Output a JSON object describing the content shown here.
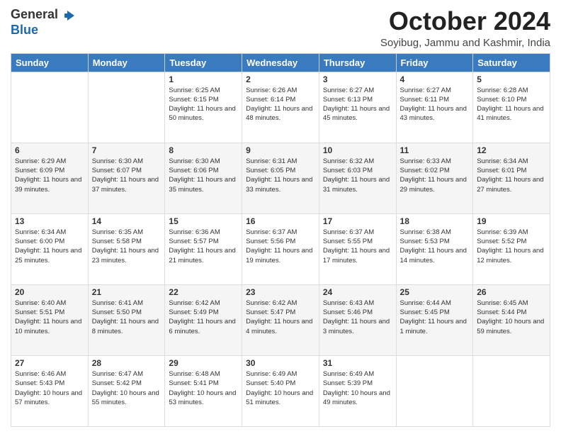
{
  "header": {
    "logo_general": "General",
    "logo_blue": "Blue",
    "month_title": "October 2024",
    "subtitle": "Soyibug, Jammu and Kashmir, India"
  },
  "days_of_week": [
    "Sunday",
    "Monday",
    "Tuesday",
    "Wednesday",
    "Thursday",
    "Friday",
    "Saturday"
  ],
  "weeks": [
    [
      {
        "day": "",
        "sunrise": "",
        "sunset": "",
        "daylight": ""
      },
      {
        "day": "",
        "sunrise": "",
        "sunset": "",
        "daylight": ""
      },
      {
        "day": "1",
        "sunrise": "Sunrise: 6:25 AM",
        "sunset": "Sunset: 6:15 PM",
        "daylight": "Daylight: 11 hours and 50 minutes."
      },
      {
        "day": "2",
        "sunrise": "Sunrise: 6:26 AM",
        "sunset": "Sunset: 6:14 PM",
        "daylight": "Daylight: 11 hours and 48 minutes."
      },
      {
        "day": "3",
        "sunrise": "Sunrise: 6:27 AM",
        "sunset": "Sunset: 6:13 PM",
        "daylight": "Daylight: 11 hours and 45 minutes."
      },
      {
        "day": "4",
        "sunrise": "Sunrise: 6:27 AM",
        "sunset": "Sunset: 6:11 PM",
        "daylight": "Daylight: 11 hours and 43 minutes."
      },
      {
        "day": "5",
        "sunrise": "Sunrise: 6:28 AM",
        "sunset": "Sunset: 6:10 PM",
        "daylight": "Daylight: 11 hours and 41 minutes."
      }
    ],
    [
      {
        "day": "6",
        "sunrise": "Sunrise: 6:29 AM",
        "sunset": "Sunset: 6:09 PM",
        "daylight": "Daylight: 11 hours and 39 minutes."
      },
      {
        "day": "7",
        "sunrise": "Sunrise: 6:30 AM",
        "sunset": "Sunset: 6:07 PM",
        "daylight": "Daylight: 11 hours and 37 minutes."
      },
      {
        "day": "8",
        "sunrise": "Sunrise: 6:30 AM",
        "sunset": "Sunset: 6:06 PM",
        "daylight": "Daylight: 11 hours and 35 minutes."
      },
      {
        "day": "9",
        "sunrise": "Sunrise: 6:31 AM",
        "sunset": "Sunset: 6:05 PM",
        "daylight": "Daylight: 11 hours and 33 minutes."
      },
      {
        "day": "10",
        "sunrise": "Sunrise: 6:32 AM",
        "sunset": "Sunset: 6:03 PM",
        "daylight": "Daylight: 11 hours and 31 minutes."
      },
      {
        "day": "11",
        "sunrise": "Sunrise: 6:33 AM",
        "sunset": "Sunset: 6:02 PM",
        "daylight": "Daylight: 11 hours and 29 minutes."
      },
      {
        "day": "12",
        "sunrise": "Sunrise: 6:34 AM",
        "sunset": "Sunset: 6:01 PM",
        "daylight": "Daylight: 11 hours and 27 minutes."
      }
    ],
    [
      {
        "day": "13",
        "sunrise": "Sunrise: 6:34 AM",
        "sunset": "Sunset: 6:00 PM",
        "daylight": "Daylight: 11 hours and 25 minutes."
      },
      {
        "day": "14",
        "sunrise": "Sunrise: 6:35 AM",
        "sunset": "Sunset: 5:58 PM",
        "daylight": "Daylight: 11 hours and 23 minutes."
      },
      {
        "day": "15",
        "sunrise": "Sunrise: 6:36 AM",
        "sunset": "Sunset: 5:57 PM",
        "daylight": "Daylight: 11 hours and 21 minutes."
      },
      {
        "day": "16",
        "sunrise": "Sunrise: 6:37 AM",
        "sunset": "Sunset: 5:56 PM",
        "daylight": "Daylight: 11 hours and 19 minutes."
      },
      {
        "day": "17",
        "sunrise": "Sunrise: 6:37 AM",
        "sunset": "Sunset: 5:55 PM",
        "daylight": "Daylight: 11 hours and 17 minutes."
      },
      {
        "day": "18",
        "sunrise": "Sunrise: 6:38 AM",
        "sunset": "Sunset: 5:53 PM",
        "daylight": "Daylight: 11 hours and 14 minutes."
      },
      {
        "day": "19",
        "sunrise": "Sunrise: 6:39 AM",
        "sunset": "Sunset: 5:52 PM",
        "daylight": "Daylight: 11 hours and 12 minutes."
      }
    ],
    [
      {
        "day": "20",
        "sunrise": "Sunrise: 6:40 AM",
        "sunset": "Sunset: 5:51 PM",
        "daylight": "Daylight: 11 hours and 10 minutes."
      },
      {
        "day": "21",
        "sunrise": "Sunrise: 6:41 AM",
        "sunset": "Sunset: 5:50 PM",
        "daylight": "Daylight: 11 hours and 8 minutes."
      },
      {
        "day": "22",
        "sunrise": "Sunrise: 6:42 AM",
        "sunset": "Sunset: 5:49 PM",
        "daylight": "Daylight: 11 hours and 6 minutes."
      },
      {
        "day": "23",
        "sunrise": "Sunrise: 6:42 AM",
        "sunset": "Sunset: 5:47 PM",
        "daylight": "Daylight: 11 hours and 4 minutes."
      },
      {
        "day": "24",
        "sunrise": "Sunrise: 6:43 AM",
        "sunset": "Sunset: 5:46 PM",
        "daylight": "Daylight: 11 hours and 3 minutes."
      },
      {
        "day": "25",
        "sunrise": "Sunrise: 6:44 AM",
        "sunset": "Sunset: 5:45 PM",
        "daylight": "Daylight: 11 hours and 1 minute."
      },
      {
        "day": "26",
        "sunrise": "Sunrise: 6:45 AM",
        "sunset": "Sunset: 5:44 PM",
        "daylight": "Daylight: 10 hours and 59 minutes."
      }
    ],
    [
      {
        "day": "27",
        "sunrise": "Sunrise: 6:46 AM",
        "sunset": "Sunset: 5:43 PM",
        "daylight": "Daylight: 10 hours and 57 minutes."
      },
      {
        "day": "28",
        "sunrise": "Sunrise: 6:47 AM",
        "sunset": "Sunset: 5:42 PM",
        "daylight": "Daylight: 10 hours and 55 minutes."
      },
      {
        "day": "29",
        "sunrise": "Sunrise: 6:48 AM",
        "sunset": "Sunset: 5:41 PM",
        "daylight": "Daylight: 10 hours and 53 minutes."
      },
      {
        "day": "30",
        "sunrise": "Sunrise: 6:49 AM",
        "sunset": "Sunset: 5:40 PM",
        "daylight": "Daylight: 10 hours and 51 minutes."
      },
      {
        "day": "31",
        "sunrise": "Sunrise: 6:49 AM",
        "sunset": "Sunset: 5:39 PM",
        "daylight": "Daylight: 10 hours and 49 minutes."
      },
      {
        "day": "",
        "sunrise": "",
        "sunset": "",
        "daylight": ""
      },
      {
        "day": "",
        "sunrise": "",
        "sunset": "",
        "daylight": ""
      }
    ]
  ]
}
